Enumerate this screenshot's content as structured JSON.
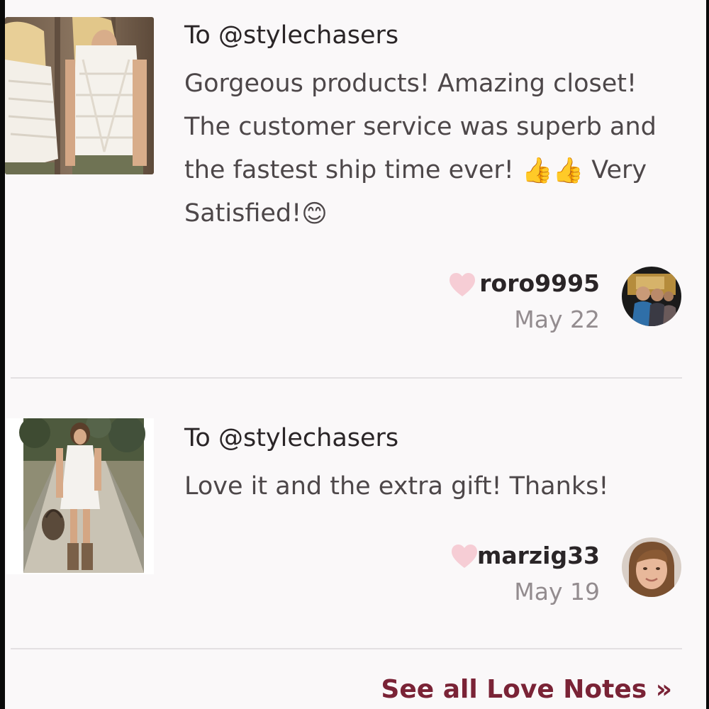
{
  "notes": [
    {
      "to": "To @stylechasers",
      "message_parts": {
        "text1": "Gorgeous products! Amazing closet! The customer service was superb and the fastest ship time ever!",
        "emoji1": "👍👍",
        "text2": "Very Satisfied!",
        "emoji2": "😊"
      },
      "username": "roro9995",
      "date": "May 22",
      "heart_icon": "heart-icon",
      "heart_color": "#f6cdd5"
    },
    {
      "to": "To @stylechasers",
      "message": "Love it and the extra gift! Thanks!",
      "username": "marzig33",
      "date": "May 19",
      "heart_icon": "heart-icon",
      "heart_color": "#f6cdd5"
    }
  ],
  "footer": {
    "see_all_label": "See all Love Notes »"
  },
  "colors": {
    "background": "#faf8f9",
    "accent": "#7a2336",
    "text": "#2a2527",
    "muted": "#938c8f"
  }
}
